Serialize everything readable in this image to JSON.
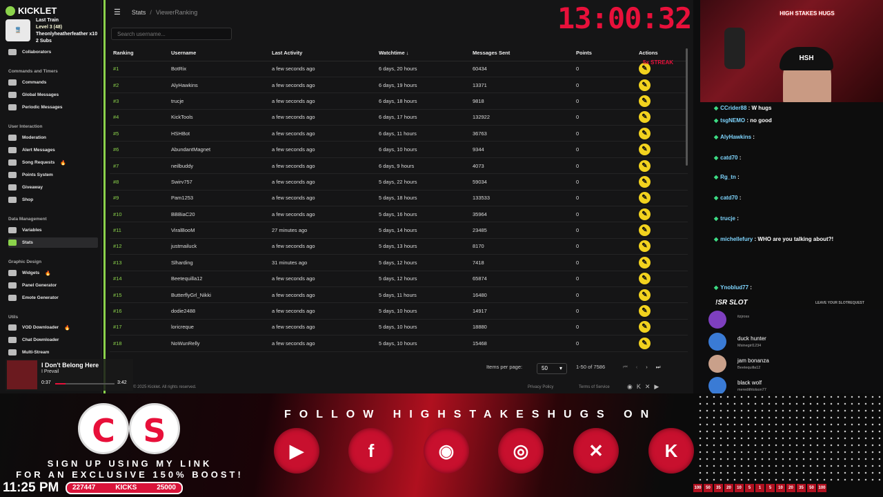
{
  "app": {
    "name": "KICKLET"
  },
  "alert": {
    "line1": "Last Train",
    "line2": "Level 3 (48)",
    "line3": "Theonlyheatherfeather x10",
    "line4": "2 Subs"
  },
  "sidebar": {
    "sections": [
      {
        "title": "Commands and Timers"
      },
      {
        "title": "User Interaction"
      },
      {
        "title": "Data Management"
      },
      {
        "title": "Graphic Design"
      },
      {
        "title": "Utils"
      }
    ],
    "items": [
      {
        "label": "Collaborators"
      },
      {
        "label": "Commands"
      },
      {
        "label": "Global Messages"
      },
      {
        "label": "Periodic Messages"
      },
      {
        "label": "Moderation"
      },
      {
        "label": "Alert Messages"
      },
      {
        "label": "Song Requests"
      },
      {
        "label": "Points System"
      },
      {
        "label": "Giveaway"
      },
      {
        "label": "Shop"
      },
      {
        "label": "Variables"
      },
      {
        "label": "Stats"
      },
      {
        "label": "Widgets"
      },
      {
        "label": "Panel Generator"
      },
      {
        "label": "Emote Generator"
      },
      {
        "label": "VOD Downloader"
      },
      {
        "label": "Chat Downloader"
      },
      {
        "label": "Multi-Stream"
      }
    ],
    "active": "Stats"
  },
  "breadcrumb": {
    "root": "Stats",
    "sep": "/",
    "current": "ViewerRanking"
  },
  "search": {
    "placeholder": "Search username..."
  },
  "table": {
    "headers": [
      "Ranking",
      "Username",
      "Last Activity",
      "Watchtime ↓",
      "Messages Sent",
      "Points",
      "Actions"
    ],
    "rows": [
      [
        "#1",
        "BotRix",
        "a few seconds ago",
        "6 days, 20 hours",
        "60434",
        "0"
      ],
      [
        "#2",
        "AlyHawkins",
        "a few seconds ago",
        "6 days, 19 hours",
        "13371",
        "0"
      ],
      [
        "#3",
        "trucje",
        "a few seconds ago",
        "6 days, 18 hours",
        "9818",
        "0"
      ],
      [
        "#4",
        "KickTools",
        "a few seconds ago",
        "6 days, 17 hours",
        "132922",
        "0"
      ],
      [
        "#5",
        "HSHBot",
        "a few seconds ago",
        "6 days, 11 hours",
        "36763",
        "0"
      ],
      [
        "#6",
        "AbundantMagnet",
        "a few seconds ago",
        "6 days, 10 hours",
        "9344",
        "0"
      ],
      [
        "#7",
        "neilbuddy",
        "a few seconds ago",
        "6 days, 9 hours",
        "4073",
        "0"
      ],
      [
        "#8",
        "Swirv757",
        "a few seconds ago",
        "5 days, 22 hours",
        "59034",
        "0"
      ],
      [
        "#9",
        "Pam1253",
        "a few seconds ago",
        "5 days, 18 hours",
        "133533",
        "0"
      ],
      [
        "#10",
        "BBBiaC20",
        "a few seconds ago",
        "5 days, 16 hours",
        "35964",
        "0"
      ],
      [
        "#11",
        "ViralBooM",
        "27 minutes ago",
        "5 days, 14 hours",
        "23485",
        "0"
      ],
      [
        "#12",
        "justmailuck",
        "a few seconds ago",
        "5 days, 13 hours",
        "8170",
        "0"
      ],
      [
        "#13",
        "Slharding",
        "31 minutes ago",
        "5 days, 12 hours",
        "7418",
        "0"
      ],
      [
        "#14",
        "Beetequilla12",
        "a few seconds ago",
        "5 days, 12 hours",
        "65874",
        "0"
      ],
      [
        "#15",
        "ButterflyGrl_Nikki",
        "a few seconds ago",
        "5 days, 11 hours",
        "16480",
        "0"
      ],
      [
        "#16",
        "dodie2488",
        "a few seconds ago",
        "5 days, 10 hours",
        "14917",
        "0"
      ],
      [
        "#17",
        "loricreque",
        "a few seconds ago",
        "5 days, 10 hours",
        "18880",
        "0"
      ],
      [
        "#18",
        "NoWunRelly",
        "a few seconds ago",
        "5 days, 10 hours",
        "15468",
        "0"
      ]
    ]
  },
  "pager": {
    "items_label": "Items per page:",
    "per_page": "50",
    "range": "1-50 of 7586"
  },
  "footer": {
    "copyright": "© 2025 Kicklet. All rights reserved.",
    "privacy": "Privacy Policy",
    "terms": "Terms of Service"
  },
  "clock": "13:00:32",
  "streak": "5x STREAK",
  "cam": {
    "sign": "HIGH STAKES HUGS",
    "hat": "HSH"
  },
  "chat": [
    {
      "user": "CCrider88",
      "msg": ": W hugs"
    },
    {
      "user": "tsgNEMO",
      "msg": ": no good"
    },
    {
      "user": "AlyHawkins",
      "msg": ":"
    },
    {
      "user": "catd70",
      "msg": ":"
    },
    {
      "user": "Rg_tn",
      "msg": ":"
    },
    {
      "user": "catd70",
      "msg": ":"
    },
    {
      "user": "trucje",
      "msg": ":"
    },
    {
      "user": "michellefury",
      "msg": ": WHO are you talking about?!"
    },
    {
      "user": "Ynoblud77",
      "msg": ":"
    }
  ],
  "slot": {
    "title": "!SR SLOT",
    "leave": "LEAVE YOUR SLOTREQUEST",
    "items": [
      {
        "game": "",
        "user": "itzjross"
      },
      {
        "game": "duck hunter",
        "user": "Msinegirl1234"
      },
      {
        "game": "jam bonanza",
        "user": "Beetequilla12"
      },
      {
        "game": "black wolf",
        "user": "meredithlolson77"
      }
    ]
  },
  "music": {
    "title": "I Don't Belong Here",
    "artist": "I Prevail",
    "current": "0:37",
    "duration": "3:42",
    "progress": 0.17
  },
  "bottom": {
    "signup1": "SIGN UP USING MY LINK",
    "signup2": "FOR AN EXCLUSIVE 150% BOOST!",
    "follow": "FOLLOW HIGHSTAKESHUGS ON",
    "time": "11:25 PM",
    "goal_current": "227447",
    "goal_label": "KICKS",
    "goal_target": "25000",
    "bar_numbers": [
      "100",
      "50",
      "35",
      "20",
      "10",
      "5",
      "1",
      "5",
      "10",
      "20",
      "35",
      "50",
      "100"
    ]
  },
  "colors": {
    "accent": "#8bd34b",
    "brand_red": "#e8103a",
    "action": "#f2d21e"
  }
}
